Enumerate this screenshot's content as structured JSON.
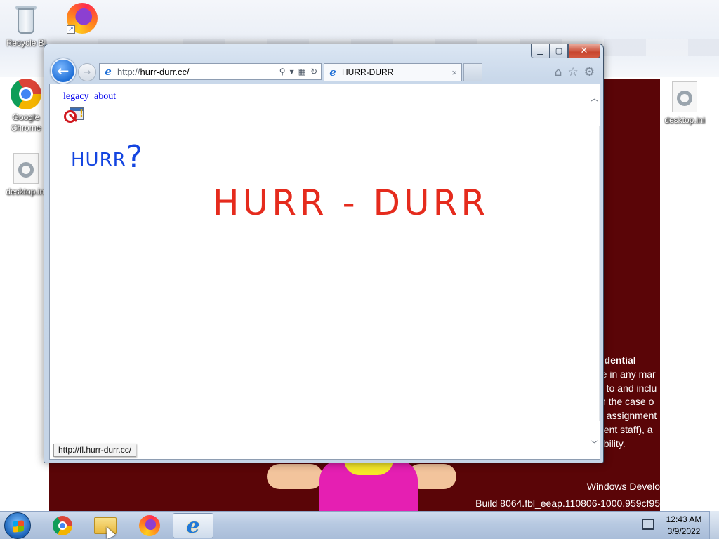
{
  "desktop": {
    "icons": [
      {
        "label": "Recycle Bi"
      },
      {
        "label": ""
      },
      {
        "label": "Google Chrome"
      },
      {
        "label": "desktop.ini"
      },
      {
        "label": "desktop.ini"
      }
    ],
    "wallpaper_text": {
      "confidential_lines": [
        "fidential",
        "re in any mar",
        "p to and inclu",
        "in the case o",
        "h assignment",
        "gent staff), a",
        "ability."
      ],
      "build_line1": "Windows Develo",
      "build_line2": "Build 8064.fbl_eeap.110806-1000.959cf95"
    }
  },
  "browser": {
    "address": {
      "protocol": "http://",
      "domain": "hurr-durr.cc/"
    },
    "tab": {
      "title": "HURR-DURR",
      "close": "×"
    },
    "page": {
      "links": [
        "legacy",
        "about"
      ],
      "hurr_word": "HURR",
      "hurr_mark": "?",
      "title": "HURR - DURR"
    },
    "status_url": "http://fl.hurr-durr.cc/"
  },
  "taskbar": {
    "clock_time": "12:43 AM",
    "clock_date": "3/9/2022"
  },
  "colors": {
    "link": "#0000ee",
    "hurr_blue": "#1445e0",
    "title_red": "#e52b1d",
    "poster_bg": "#5a0507"
  }
}
